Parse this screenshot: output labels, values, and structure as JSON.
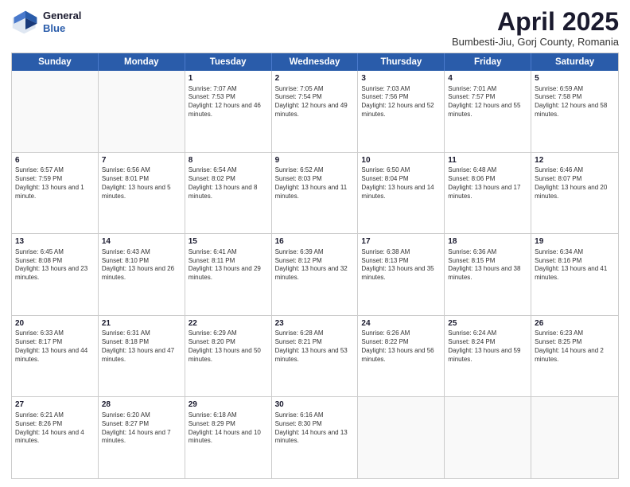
{
  "header": {
    "logo_general": "General",
    "logo_blue": "Blue",
    "month_title": "April 2025",
    "subtitle": "Bumbesti-Jiu, Gorj County, Romania"
  },
  "days": [
    "Sunday",
    "Monday",
    "Tuesday",
    "Wednesday",
    "Thursday",
    "Friday",
    "Saturday"
  ],
  "weeks": [
    [
      {
        "day": "",
        "empty": true
      },
      {
        "day": "",
        "empty": true
      },
      {
        "day": "1",
        "sunrise": "Sunrise: 7:07 AM",
        "sunset": "Sunset: 7:53 PM",
        "daylight": "Daylight: 12 hours and 46 minutes."
      },
      {
        "day": "2",
        "sunrise": "Sunrise: 7:05 AM",
        "sunset": "Sunset: 7:54 PM",
        "daylight": "Daylight: 12 hours and 49 minutes."
      },
      {
        "day": "3",
        "sunrise": "Sunrise: 7:03 AM",
        "sunset": "Sunset: 7:56 PM",
        "daylight": "Daylight: 12 hours and 52 minutes."
      },
      {
        "day": "4",
        "sunrise": "Sunrise: 7:01 AM",
        "sunset": "Sunset: 7:57 PM",
        "daylight": "Daylight: 12 hours and 55 minutes."
      },
      {
        "day": "5",
        "sunrise": "Sunrise: 6:59 AM",
        "sunset": "Sunset: 7:58 PM",
        "daylight": "Daylight: 12 hours and 58 minutes."
      }
    ],
    [
      {
        "day": "6",
        "sunrise": "Sunrise: 6:57 AM",
        "sunset": "Sunset: 7:59 PM",
        "daylight": "Daylight: 13 hours and 1 minute."
      },
      {
        "day": "7",
        "sunrise": "Sunrise: 6:56 AM",
        "sunset": "Sunset: 8:01 PM",
        "daylight": "Daylight: 13 hours and 5 minutes."
      },
      {
        "day": "8",
        "sunrise": "Sunrise: 6:54 AM",
        "sunset": "Sunset: 8:02 PM",
        "daylight": "Daylight: 13 hours and 8 minutes."
      },
      {
        "day": "9",
        "sunrise": "Sunrise: 6:52 AM",
        "sunset": "Sunset: 8:03 PM",
        "daylight": "Daylight: 13 hours and 11 minutes."
      },
      {
        "day": "10",
        "sunrise": "Sunrise: 6:50 AM",
        "sunset": "Sunset: 8:04 PM",
        "daylight": "Daylight: 13 hours and 14 minutes."
      },
      {
        "day": "11",
        "sunrise": "Sunrise: 6:48 AM",
        "sunset": "Sunset: 8:06 PM",
        "daylight": "Daylight: 13 hours and 17 minutes."
      },
      {
        "day": "12",
        "sunrise": "Sunrise: 6:46 AM",
        "sunset": "Sunset: 8:07 PM",
        "daylight": "Daylight: 13 hours and 20 minutes."
      }
    ],
    [
      {
        "day": "13",
        "sunrise": "Sunrise: 6:45 AM",
        "sunset": "Sunset: 8:08 PM",
        "daylight": "Daylight: 13 hours and 23 minutes."
      },
      {
        "day": "14",
        "sunrise": "Sunrise: 6:43 AM",
        "sunset": "Sunset: 8:10 PM",
        "daylight": "Daylight: 13 hours and 26 minutes."
      },
      {
        "day": "15",
        "sunrise": "Sunrise: 6:41 AM",
        "sunset": "Sunset: 8:11 PM",
        "daylight": "Daylight: 13 hours and 29 minutes."
      },
      {
        "day": "16",
        "sunrise": "Sunrise: 6:39 AM",
        "sunset": "Sunset: 8:12 PM",
        "daylight": "Daylight: 13 hours and 32 minutes."
      },
      {
        "day": "17",
        "sunrise": "Sunrise: 6:38 AM",
        "sunset": "Sunset: 8:13 PM",
        "daylight": "Daylight: 13 hours and 35 minutes."
      },
      {
        "day": "18",
        "sunrise": "Sunrise: 6:36 AM",
        "sunset": "Sunset: 8:15 PM",
        "daylight": "Daylight: 13 hours and 38 minutes."
      },
      {
        "day": "19",
        "sunrise": "Sunrise: 6:34 AM",
        "sunset": "Sunset: 8:16 PM",
        "daylight": "Daylight: 13 hours and 41 minutes."
      }
    ],
    [
      {
        "day": "20",
        "sunrise": "Sunrise: 6:33 AM",
        "sunset": "Sunset: 8:17 PM",
        "daylight": "Daylight: 13 hours and 44 minutes."
      },
      {
        "day": "21",
        "sunrise": "Sunrise: 6:31 AM",
        "sunset": "Sunset: 8:18 PM",
        "daylight": "Daylight: 13 hours and 47 minutes."
      },
      {
        "day": "22",
        "sunrise": "Sunrise: 6:29 AM",
        "sunset": "Sunset: 8:20 PM",
        "daylight": "Daylight: 13 hours and 50 minutes."
      },
      {
        "day": "23",
        "sunrise": "Sunrise: 6:28 AM",
        "sunset": "Sunset: 8:21 PM",
        "daylight": "Daylight: 13 hours and 53 minutes."
      },
      {
        "day": "24",
        "sunrise": "Sunrise: 6:26 AM",
        "sunset": "Sunset: 8:22 PM",
        "daylight": "Daylight: 13 hours and 56 minutes."
      },
      {
        "day": "25",
        "sunrise": "Sunrise: 6:24 AM",
        "sunset": "Sunset: 8:24 PM",
        "daylight": "Daylight: 13 hours and 59 minutes."
      },
      {
        "day": "26",
        "sunrise": "Sunrise: 6:23 AM",
        "sunset": "Sunset: 8:25 PM",
        "daylight": "Daylight: 14 hours and 2 minutes."
      }
    ],
    [
      {
        "day": "27",
        "sunrise": "Sunrise: 6:21 AM",
        "sunset": "Sunset: 8:26 PM",
        "daylight": "Daylight: 14 hours and 4 minutes."
      },
      {
        "day": "28",
        "sunrise": "Sunrise: 6:20 AM",
        "sunset": "Sunset: 8:27 PM",
        "daylight": "Daylight: 14 hours and 7 minutes."
      },
      {
        "day": "29",
        "sunrise": "Sunrise: 6:18 AM",
        "sunset": "Sunset: 8:29 PM",
        "daylight": "Daylight: 14 hours and 10 minutes."
      },
      {
        "day": "30",
        "sunrise": "Sunrise: 6:16 AM",
        "sunset": "Sunset: 8:30 PM",
        "daylight": "Daylight: 14 hours and 13 minutes."
      },
      {
        "day": "",
        "empty": true
      },
      {
        "day": "",
        "empty": true
      },
      {
        "day": "",
        "empty": true
      }
    ]
  ]
}
